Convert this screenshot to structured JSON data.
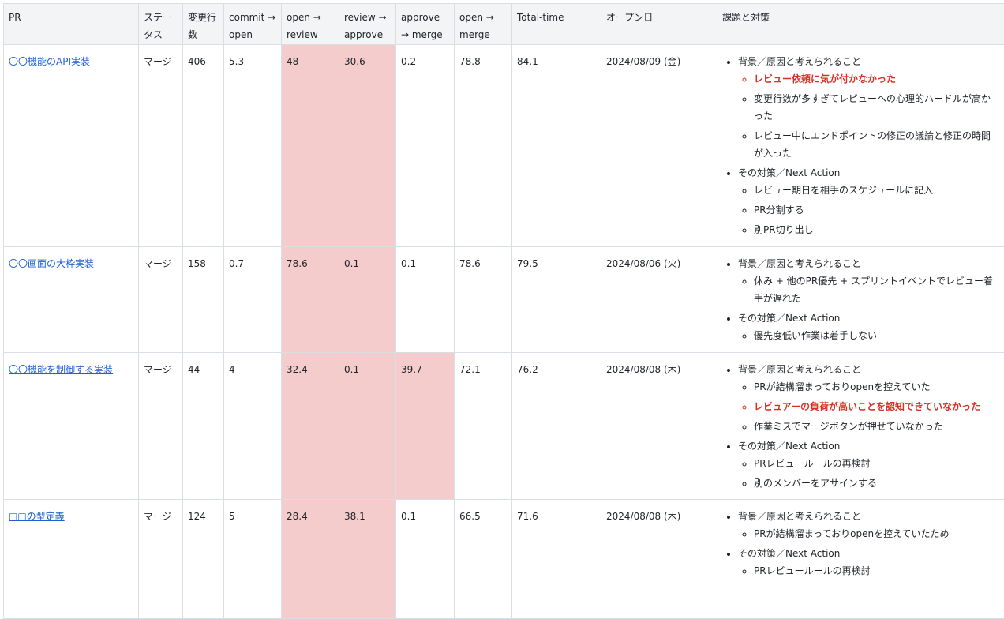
{
  "headers": [
    "PR",
    "ステータス",
    "変更行数",
    "commit → open",
    "open → review",
    "review → approve",
    "approve → merge",
    "open → merge",
    "Total-time",
    "オープン日",
    "課題と対策"
  ],
  "rows": [
    {
      "pr": "〇〇機能のAPI実装",
      "status": "マージ",
      "lines": "406",
      "commit_open": "5.3",
      "open_review": "48",
      "review_approve": "30.6",
      "approve_merge": "0.2",
      "open_merge": "78.8",
      "total": "84.1",
      "date": "2024/08/09 (金)",
      "bg_label": "背景／原因と考えられること",
      "causes": [
        {
          "text": "レビュー依頼に気が付かなかった",
          "highlight": true
        },
        {
          "text": "変更行数が多すぎてレビューへの心理的ハードルが高かった",
          "highlight": false
        },
        {
          "text": "レビュー中にエンドポイントの修正の議論と修正の時間が入った",
          "highlight": false
        }
      ],
      "action_label": "その対策／Next Action",
      "actions": [
        "レビュー期日を相手のスケジュールに記入",
        "PR分割する",
        "別PR切り出し"
      ]
    },
    {
      "pr": "〇〇画面の大枠実装",
      "status": "マージ",
      "lines": "158",
      "commit_open": "0.7",
      "open_review": "78.6",
      "review_approve": "0.1",
      "approve_merge": "0.1",
      "open_merge": "78.6",
      "total": "79.5",
      "date": "2024/08/06 (火)",
      "bg_label": "背景／原因と考えられること",
      "causes": [
        {
          "text": "休み + 他のPR優先 + スプリントイベントでレビュー着手が遅れた",
          "highlight": false
        }
      ],
      "action_label": "その対策／Next Action",
      "actions": [
        "優先度低い作業は着手しない"
      ]
    },
    {
      "pr": "〇〇機能を制御する実装",
      "status": "マージ",
      "lines": "44",
      "commit_open": "4",
      "open_review": "32.4",
      "review_approve": "0.1",
      "approve_merge": "39.7",
      "open_merge": "72.1",
      "total": "76.2",
      "date": "2024/08/08 (木)",
      "bg_label": "背景／原因と考えられること",
      "causes": [
        {
          "text": "PRが結構溜まっておりopenを控えていた",
          "highlight": false
        },
        {
          "text": "レビュアーの負荷が高いことを認知できていなかった",
          "highlight": true
        },
        {
          "text": "作業ミスでマージボタンが押せていなかった",
          "highlight": false
        }
      ],
      "action_label": "その対策／Next Action",
      "actions": [
        "PRレビュールールの再検討",
        "別のメンバーをアサインする"
      ]
    },
    {
      "pr": "□□の型定義",
      "status": "マージ",
      "lines": "124",
      "commit_open": "5",
      "open_review": "28.4",
      "review_approve": "38.1",
      "approve_merge": "0.1",
      "open_merge": "66.5",
      "total": "71.6",
      "date": "2024/08/08 (木)",
      "bg_label": "背景／原因と考えられること",
      "causes": [
        {
          "text": "PRが結構溜まっておりopenを控えていたため",
          "highlight": false
        }
      ],
      "action_label": "その対策／Next Action",
      "actions": [
        "PRレビュールールの再検討"
      ]
    }
  ],
  "highlights": [
    [
      "open_review",
      "review_approve"
    ],
    [
      "open_review",
      "review_approve"
    ],
    [
      "open_review",
      "review_approve",
      "approve_merge"
    ],
    [
      "open_review",
      "review_approve"
    ]
  ],
  "colors": {
    "highlight": "#f4cccc",
    "red_text": "#d93025",
    "link": "#1f5fd0"
  }
}
